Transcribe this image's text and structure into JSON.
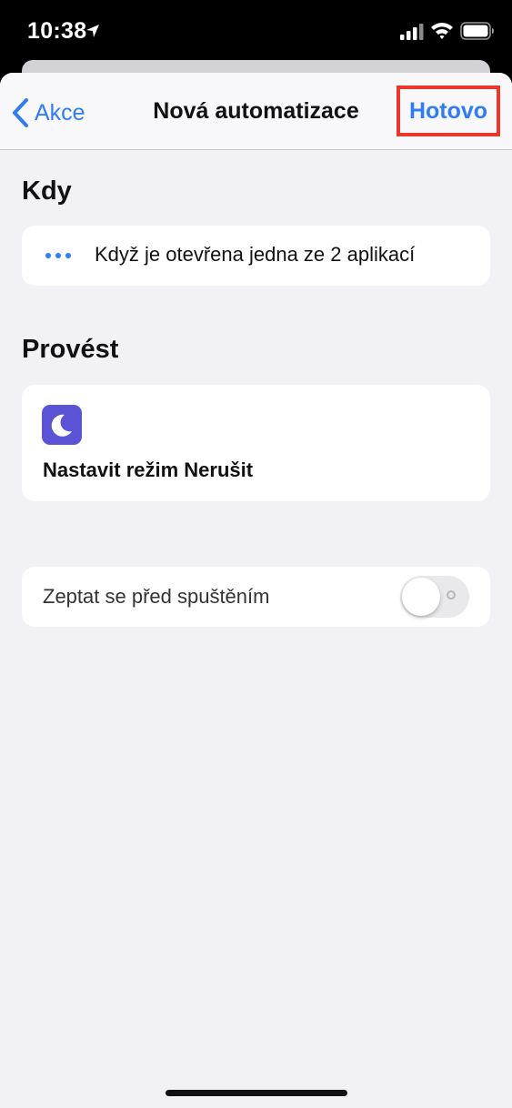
{
  "status_bar": {
    "time": "10:38",
    "icons": [
      "location-arrow-icon",
      "cellular-signal-icon",
      "wifi-icon",
      "battery-icon"
    ]
  },
  "nav": {
    "back_label": "Akce",
    "title": "Nová automatizace",
    "done_label": "Hotovo"
  },
  "sections": {
    "when_title": "Kdy",
    "when_trigger": "Když je otevřena jedna ze 2 aplikací",
    "do_title": "Provést",
    "action_label": "Nastavit režim Nerušit",
    "action_icon": "moon-icon"
  },
  "options": {
    "ask_before_running_label": "Zeptat se před spuštěním",
    "ask_before_running_on": false
  },
  "colors": {
    "accent": "#2f7cf6",
    "highlight_box": "#e8382c",
    "action_tile": "#5b53d6",
    "background": "#f1f1f6"
  }
}
